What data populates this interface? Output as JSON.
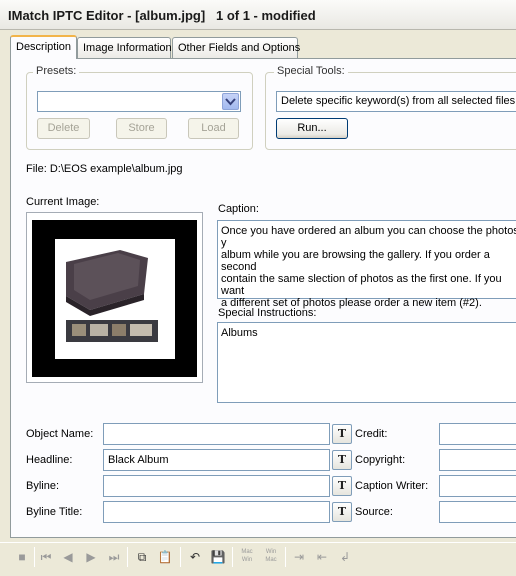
{
  "window": {
    "title": "IMatch IPTC Editor - [album.jpg]   1 of 1 - modified"
  },
  "tabs": [
    {
      "label": "Description"
    },
    {
      "label": "Image Information"
    },
    {
      "label": "Other Fields and Options"
    }
  ],
  "presets": {
    "legend": "Presets:",
    "value": "",
    "delete_label": "Delete",
    "store_label": "Store",
    "load_label": "Load"
  },
  "special_tools": {
    "legend": "Special Tools:",
    "value": "Delete specific keyword(s) from all selected files",
    "run_label": "Run..."
  },
  "file_path": "File: D:\\EOS example\\album.jpg",
  "current_image_label": "Current Image:",
  "caption": {
    "label": "Caption:",
    "text": "Once you have ordered an album you can choose the photos y\nalbum while you are browsing the gallery. If you order a second\ncontain the same slection of photos as the first one. If you want\na different set of photos please order a new item (#2)."
  },
  "special_instructions": {
    "label": "Special Instructions:",
    "text": "Albums"
  },
  "fields_left": [
    {
      "label": "Object Name:",
      "value": "",
      "t": "T"
    },
    {
      "label": "Headline:",
      "value": "Black Album",
      "t": "T"
    },
    {
      "label": "Byline:",
      "value": "",
      "t": "T"
    },
    {
      "label": "Byline Title:",
      "value": "",
      "t": "T"
    }
  ],
  "fields_right": [
    {
      "label": "Credit:",
      "value": ""
    },
    {
      "label": "Copyright:",
      "value": ""
    },
    {
      "label": "Caption Writer:",
      "value": ""
    },
    {
      "label": "Source:",
      "value": ""
    }
  ],
  "toolbar": {
    "items": [
      {
        "name": "stop-icon",
        "glyph": "■"
      },
      {
        "name": "first-icon",
        "glyph": "⏮"
      },
      {
        "name": "previous-icon",
        "glyph": "◀"
      },
      {
        "name": "next-icon",
        "glyph": "▶"
      },
      {
        "name": "last-icon",
        "glyph": "⏭"
      },
      {
        "name": "copy-icon",
        "glyph": "⧉"
      },
      {
        "name": "paste-icon",
        "glyph": "📋"
      },
      {
        "name": "undo-icon",
        "glyph": "↶"
      },
      {
        "name": "save-icon",
        "glyph": "💾"
      },
      {
        "name": "mac-win-icon",
        "glyph": "Mac\nWin"
      },
      {
        "name": "win-mac-icon",
        "glyph": "Win\nMac"
      },
      {
        "name": "import-icon",
        "glyph": "⇥"
      },
      {
        "name": "export-icon",
        "glyph": "⇤"
      },
      {
        "name": "insert-icon",
        "glyph": "↲"
      }
    ]
  }
}
